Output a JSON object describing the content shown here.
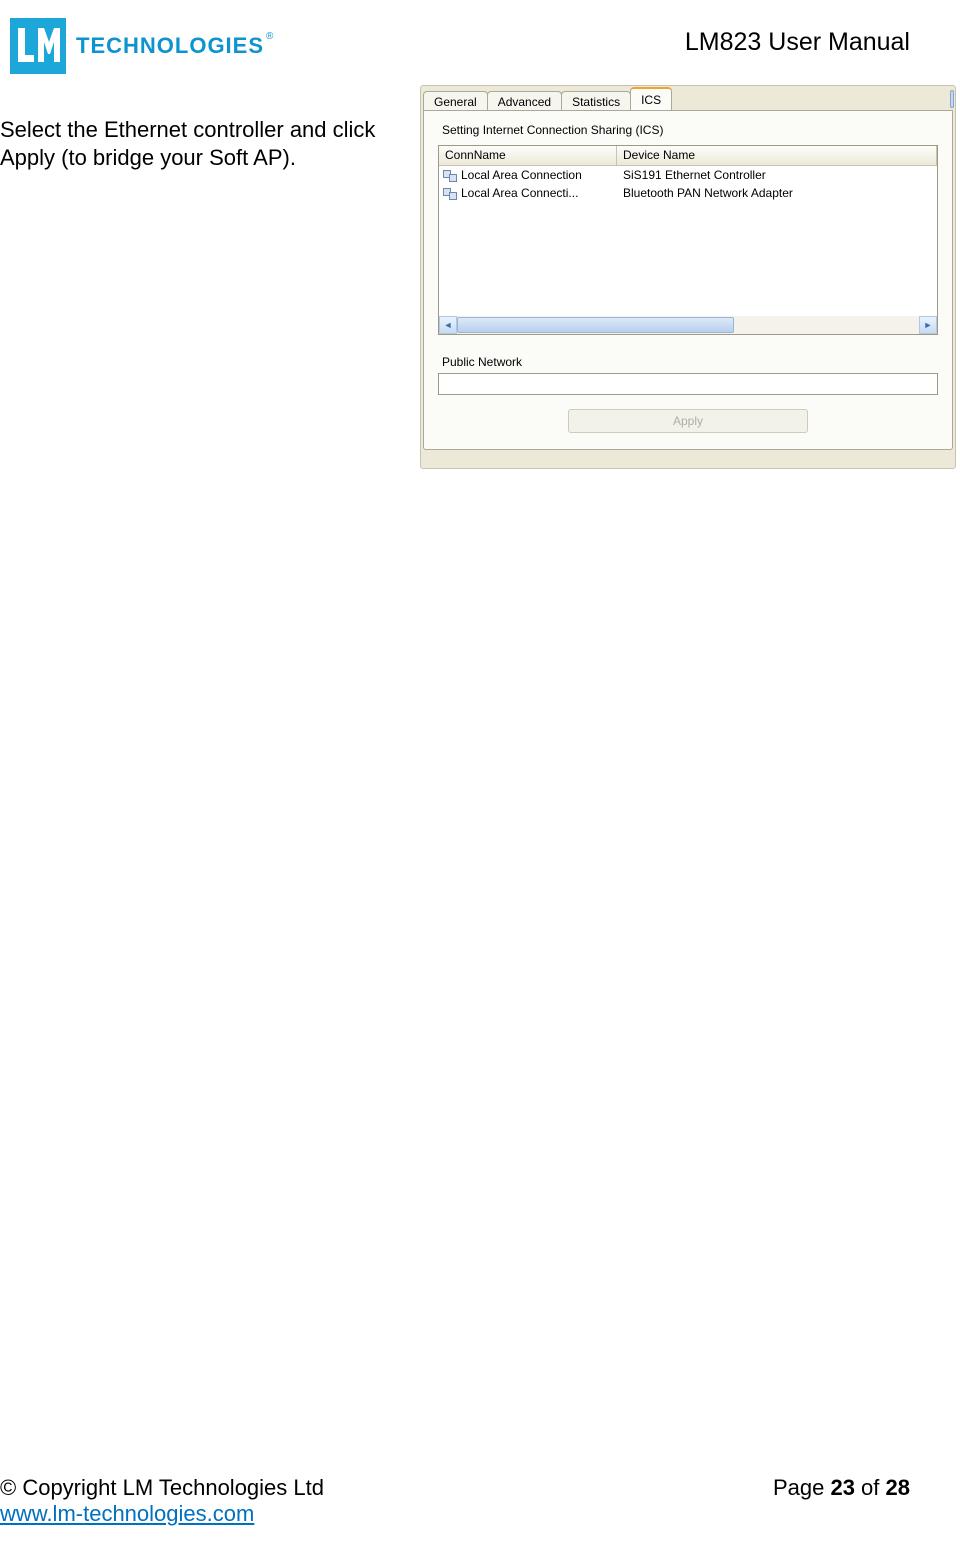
{
  "header": {
    "logo_text": "TECHNOLOGIES",
    "doc_title": "LM823 User Manual"
  },
  "instruction": "Select the Ethernet controller and click Apply (to bridge your Soft AP).",
  "dialog": {
    "tabs": [
      "General",
      "Advanced",
      "Statistics",
      "ICS"
    ],
    "active_tab": "ICS",
    "group_label": "Setting Internet Connection Sharing (ICS)",
    "columns": [
      "ConnName",
      "Device Name"
    ],
    "rows": [
      {
        "conn": "Local Area Connection",
        "device": "SiS191 Ethernet Controller"
      },
      {
        "conn": "Local Area Connecti...",
        "device": "Bluetooth PAN Network Adapter"
      }
    ],
    "public_network_label": "Public Network",
    "apply_label": "Apply"
  },
  "footer": {
    "copyright": "© Copyright LM Technologies Ltd",
    "url": "www.lm-technologies.com",
    "page_prefix": "Page ",
    "page_current": "23",
    "page_sep": " of ",
    "page_total": "28"
  }
}
